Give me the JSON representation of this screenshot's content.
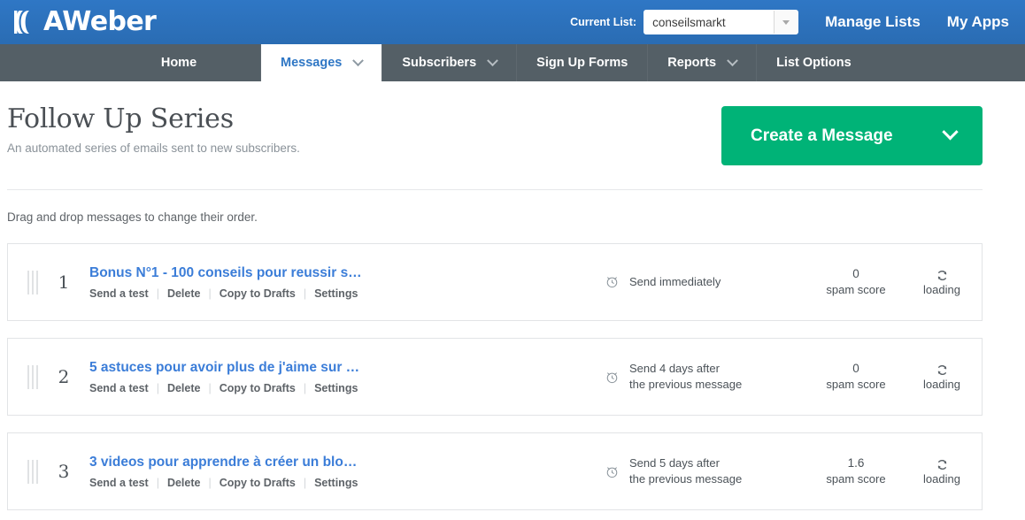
{
  "topbar": {
    "brand": "AWeber",
    "brand_icon": "aweber-logo-icon",
    "current_list_label": "Current List:",
    "current_list_value": "conseilsmarkt",
    "dropdown_icon": "chevron-down-icon",
    "manage_lists": "Manage Lists",
    "my_apps": "My Apps",
    "background_color": "#2f77c5"
  },
  "nav": {
    "items": [
      {
        "label": "Home",
        "has_caret": false,
        "active": false
      },
      {
        "label": "Messages",
        "has_caret": true,
        "active": true
      },
      {
        "label": "Subscribers",
        "has_caret": true,
        "active": false
      },
      {
        "label": "Sign Up Forms",
        "has_caret": false,
        "active": false
      },
      {
        "label": "Reports",
        "has_caret": true,
        "active": false
      },
      {
        "label": "List Options",
        "has_caret": false,
        "active": false
      }
    ],
    "background_color": "#545f66",
    "active_text_color": "#2f77c5"
  },
  "page": {
    "title": "Follow Up Series",
    "subtitle": "An automated series of emails sent to new subscribers.",
    "create_button": {
      "label": "Create a Message",
      "icon": "chevron-down-icon",
      "color": "#00b377"
    },
    "drag_hint": "Drag and drop messages to change their order."
  },
  "messages": {
    "action_labels": {
      "send_test": "Send a test",
      "delete": "Delete",
      "copy_to_drafts": "Copy to Drafts",
      "settings": "Settings"
    },
    "spam_score_label": "spam score",
    "stat_label": "loading",
    "clock_icon": "alarm-clock-icon",
    "stat_icon": "refresh-loading-icon",
    "drag_icon": "drag-handle-icon",
    "rows": [
      {
        "index": "1",
        "subject": "Bonus N°1 - 100 conseils pour reussir s…",
        "schedule": "Send immediately",
        "spam_score": "0"
      },
      {
        "index": "2",
        "subject": "5 astuces pour avoir plus de j'aime sur …",
        "schedule": "Send 4 days after\nthe previous message",
        "spam_score": "0"
      },
      {
        "index": "3",
        "subject": "3 videos pour apprendre à créer un blo…",
        "schedule": "Send 5 days after\nthe previous message",
        "spam_score": "1.6"
      }
    ]
  }
}
